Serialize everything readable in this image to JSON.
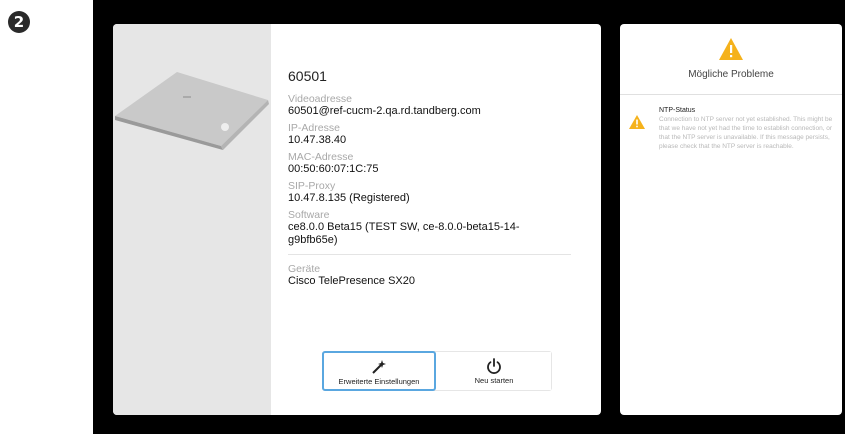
{
  "step": {
    "number": "2"
  },
  "device": {
    "name": "60501",
    "fields": [
      {
        "label": "Videoadresse",
        "value": "60501@ref-cucm-2.qa.rd.tandberg.com"
      },
      {
        "label": "IP-Adresse",
        "value": "10.47.38.40"
      },
      {
        "label": "MAC-Adresse",
        "value": "00:50:60:07:1C:75"
      },
      {
        "label": "SIP-Proxy",
        "value": "10.47.8.135 (Registered)"
      },
      {
        "label": "Software",
        "value": "ce8.0.0 Beta15 (TEST SW, ce-8.0.0-beta15-14-g9bfb65e)"
      }
    ],
    "devices_label": "Geräte",
    "devices_value": "Cisco TelePresence SX20"
  },
  "actions": {
    "advanced_label": "Erweiterte Einstellungen",
    "restart_label": "Neu starten"
  },
  "issues": {
    "title": "Mögliche Probleme",
    "items": [
      {
        "name": "NTP-Status",
        "text": "Connection to NTP server not yet established. This might be that we have not yet had the time to establish connection, or that the NTP server is unavailable. If this message persists, please check that the NTP server is reachable."
      }
    ]
  },
  "colors": {
    "warning": "#f5b21b",
    "focus": "#5aa7e0",
    "screen": "#000000"
  },
  "icons": [
    "magic-wand-icon",
    "power-icon",
    "warning-icon"
  ]
}
